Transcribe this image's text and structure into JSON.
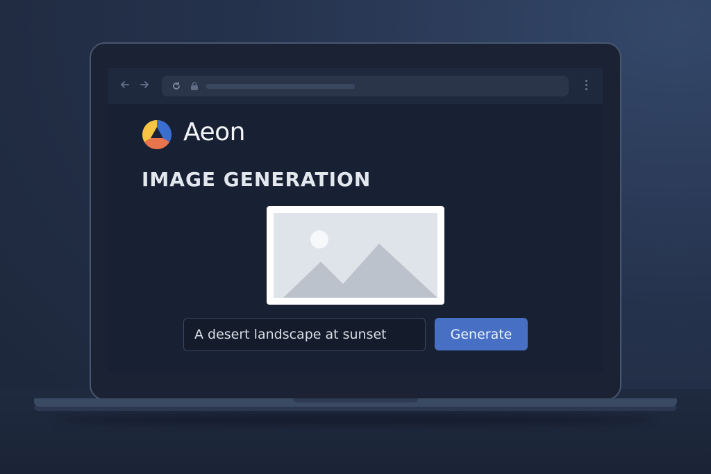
{
  "browser": {
    "back_icon": "arrow-left-icon",
    "forward_icon": "arrow-right-icon",
    "reload_icon": "reload-icon",
    "lock_icon": "lock-icon",
    "menu_icon": "more-vert-icon"
  },
  "app": {
    "brand_name": "Aeon",
    "logo_colors": [
      "#f6c544",
      "#3a6fd1",
      "#e8744d",
      "#1b2436"
    ]
  },
  "page": {
    "section_title": "IMAGE GENERATION",
    "preview_icon": "image-placeholder-icon"
  },
  "prompt": {
    "value": "A desert landscape at sunset"
  },
  "actions": {
    "generate_label": "Generate"
  },
  "colors": {
    "accent": "#4770c4",
    "screen_bg": "#182133",
    "page_bg": "#25324c"
  }
}
